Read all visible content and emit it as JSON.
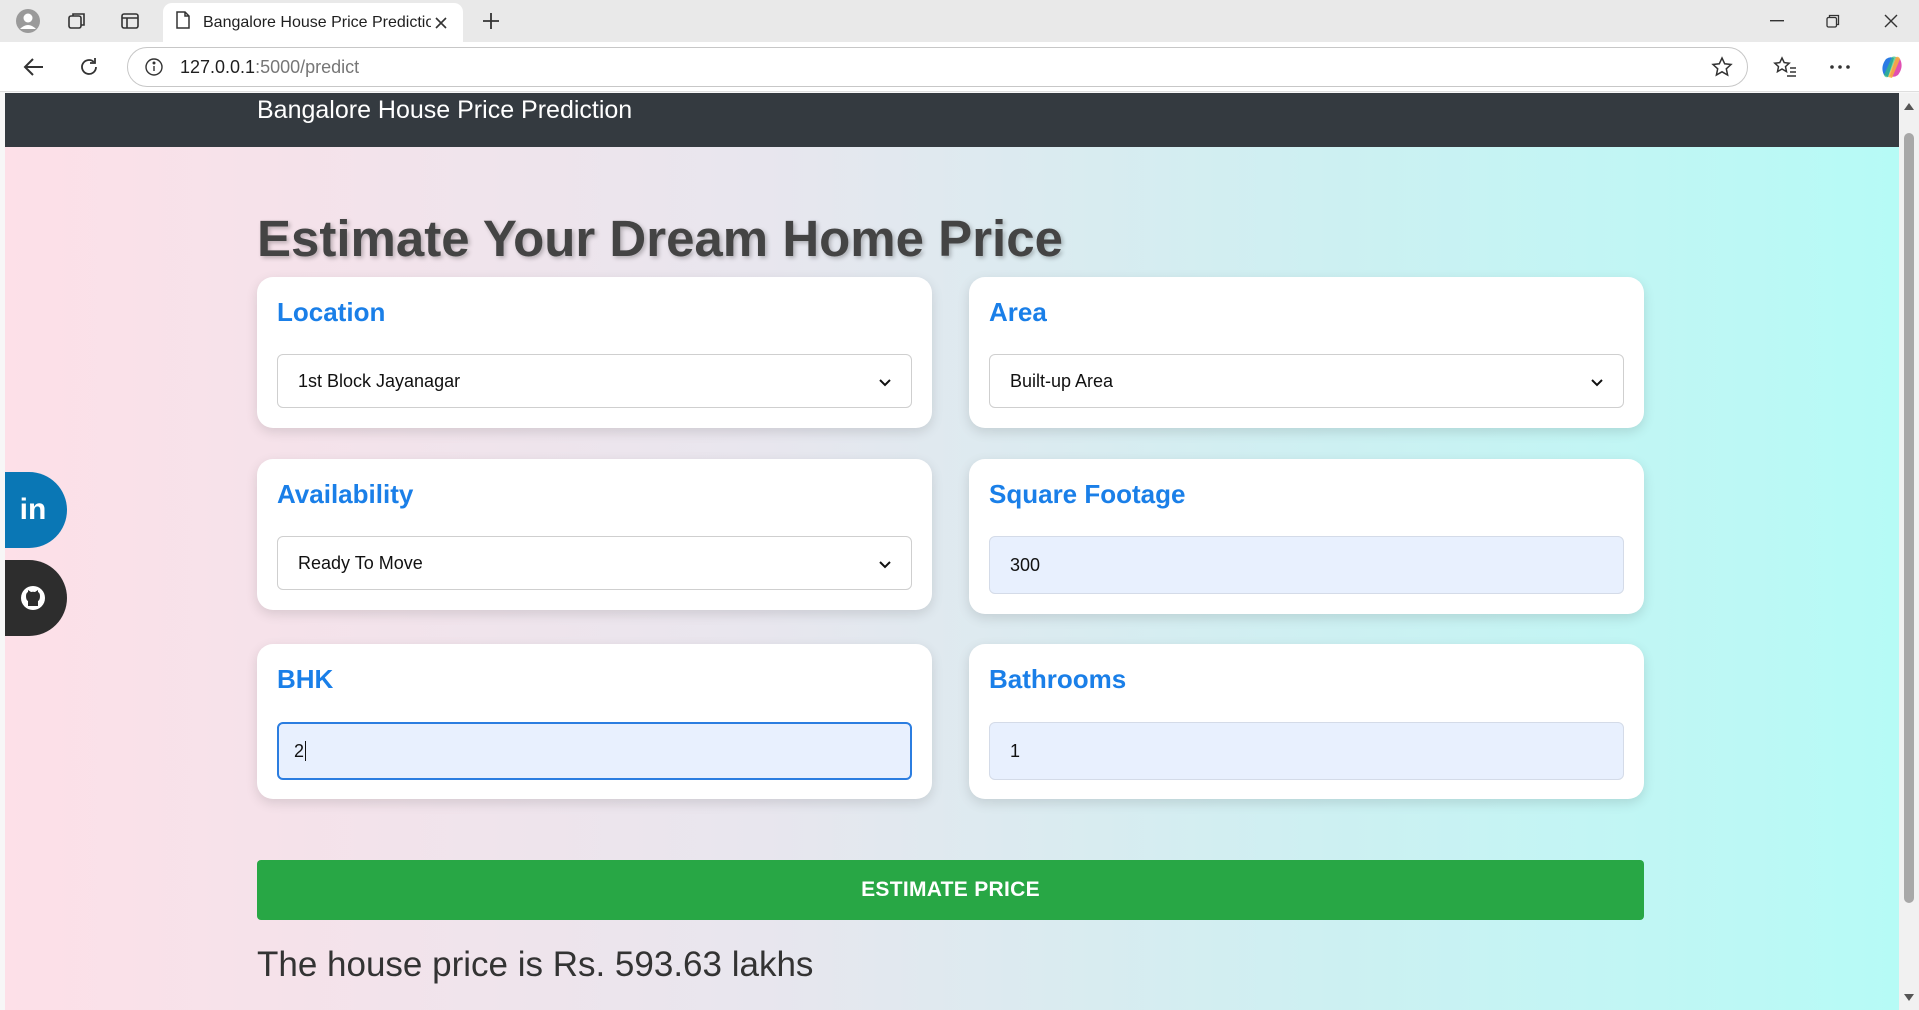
{
  "browser": {
    "tab_title": "Bangalore House Price Prediction",
    "url_host": "127.0.0.1",
    "url_path": ":5000/predict"
  },
  "page": {
    "brand": "Bangalore House Price Prediction",
    "heading": "Estimate Your Dream Home Price",
    "location": {
      "label": "Location",
      "value": "1st Block Jayanagar"
    },
    "area": {
      "label": "Area",
      "value": "Built-up Area"
    },
    "availability": {
      "label": "Availability",
      "value": "Ready To Move"
    },
    "sqft": {
      "label": "Square Footage",
      "value": "300"
    },
    "bhk": {
      "label": "BHK",
      "value": "2"
    },
    "bath": {
      "label": "Bathrooms",
      "value": "1"
    },
    "button": "ESTIMATE PRICE",
    "result": "The house price is Rs. 593.63 lakhs"
  },
  "social": {
    "linkedin_text": "in"
  },
  "colors": {
    "navbar": "#343a40",
    "label_blue": "#1a7fe8",
    "button_green": "#28a745",
    "linkedin": "#0a77b5",
    "github": "#2d2d2d"
  }
}
